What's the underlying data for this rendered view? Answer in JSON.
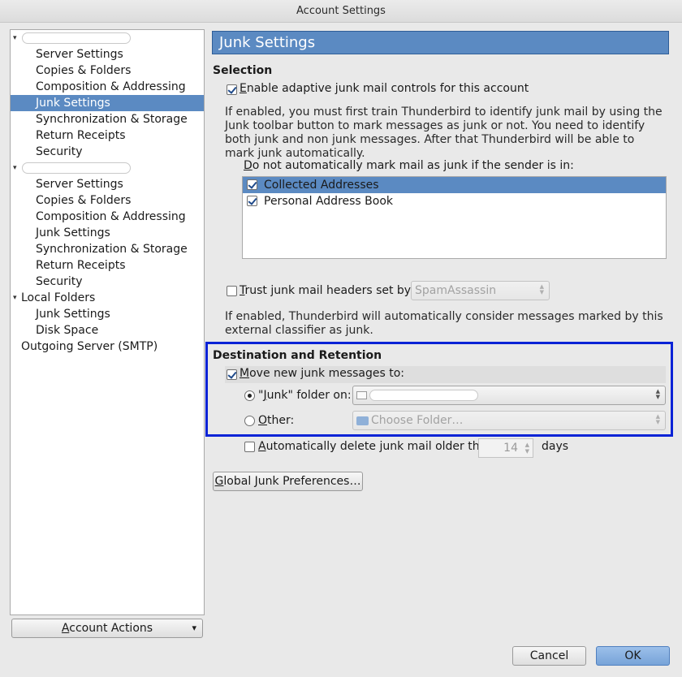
{
  "window": {
    "title": "Account Settings"
  },
  "sidebar": {
    "items": [
      {
        "label": "",
        "level": 0,
        "twisty": "▾",
        "redacted": true
      },
      {
        "label": "Server Settings",
        "level": 1
      },
      {
        "label": "Copies & Folders",
        "level": 1
      },
      {
        "label": "Composition & Addressing",
        "level": 1
      },
      {
        "label": "Junk Settings",
        "level": 1,
        "selected": true
      },
      {
        "label": "Synchronization & Storage",
        "level": 1
      },
      {
        "label": "Return Receipts",
        "level": 1
      },
      {
        "label": "Security",
        "level": 1
      },
      {
        "label": "",
        "level": 0,
        "twisty": "▾",
        "redacted": true
      },
      {
        "label": "Server Settings",
        "level": 1
      },
      {
        "label": "Copies & Folders",
        "level": 1
      },
      {
        "label": "Composition & Addressing",
        "level": 1
      },
      {
        "label": "Junk Settings",
        "level": 1
      },
      {
        "label": "Synchronization & Storage",
        "level": 1
      },
      {
        "label": "Return Receipts",
        "level": 1
      },
      {
        "label": "Security",
        "level": 1
      },
      {
        "label": "Local Folders",
        "level": 0,
        "twisty": "▾"
      },
      {
        "label": "Junk Settings",
        "level": 1
      },
      {
        "label": "Disk Space",
        "level": 1
      },
      {
        "label": "Outgoing Server (SMTP)",
        "level": 0
      }
    ],
    "account_actions": {
      "prefix": "",
      "accel": "A",
      "rest": "ccount Actions",
      "arrow": "▾"
    }
  },
  "panel": {
    "title": "Junk Settings",
    "selection": {
      "heading": "Selection",
      "adaptive": {
        "accel": "E",
        "rest": "nable adaptive junk mail controls for this account",
        "checked": true
      },
      "explanation": "If enabled, you must first train Thunderbird to identify junk mail by using the Junk toolbar button to mark messages as junk or not. You need to identify both junk and non junk messages. After that Thunderbird will be able to mark junk automatically.",
      "whitelist_label": {
        "accel": "D",
        "rest": "o not automatically mark mail as junk if the sender is in:"
      },
      "address_books": [
        {
          "label": "Collected Addresses",
          "checked": true,
          "selected": true
        },
        {
          "label": "Personal Address Book",
          "checked": true,
          "selected": false
        }
      ],
      "trust": {
        "accel": "T",
        "rest": "rust junk mail headers set by:",
        "checked": false,
        "value": "SpamAssassin"
      },
      "trust_explanation": "If enabled, Thunderbird will automatically consider messages marked by this external classifier as junk."
    },
    "destination": {
      "heading": "Destination and Retention",
      "move": {
        "accel": "M",
        "rest": "ove new junk messages to:",
        "checked": true
      },
      "junk_folder": {
        "pre": "\"",
        "accel": "J",
        "rest": "unk\" folder on:",
        "selected": true,
        "icon": "mail-account-icon"
      },
      "other": {
        "accel": "O",
        "rest": "ther:",
        "selected": false,
        "placeholder": "Choose Folder…",
        "icon": "folder-icon"
      },
      "auto_delete": {
        "accel": "A",
        "rest": "utomatically delete junk mail older than",
        "checked": false,
        "days": "14",
        "unit": "days"
      }
    },
    "global_prefs": {
      "accel": "G",
      "rest": "lobal Junk Preferences…"
    }
  },
  "dialog": {
    "cancel": "Cancel",
    "ok": "OK"
  },
  "colors": {
    "selection": "#5b8ac2",
    "highlight_box": "#0a23d6"
  }
}
